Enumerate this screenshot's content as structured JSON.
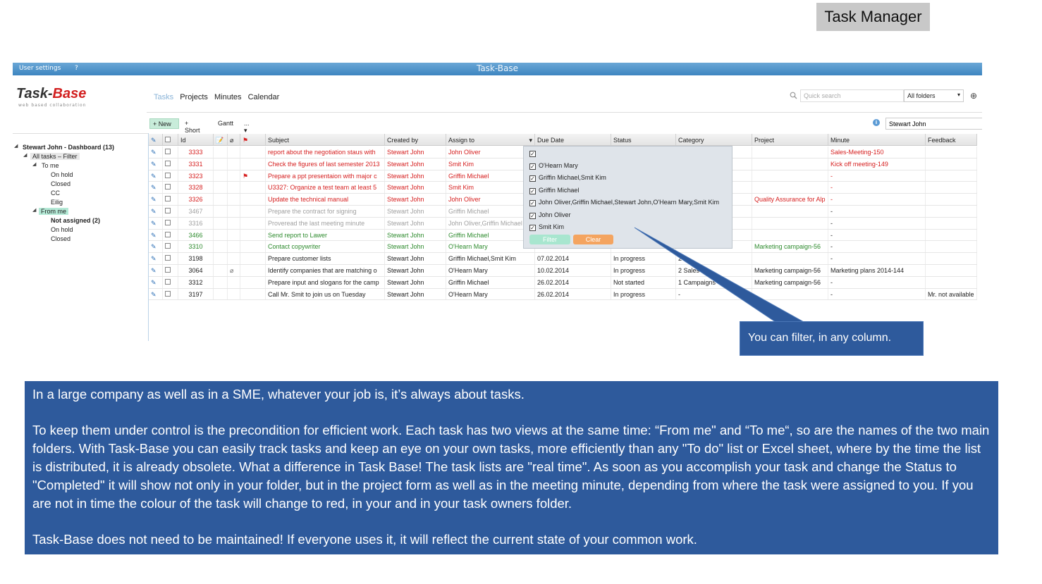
{
  "slide_title": "Task Manager",
  "app": {
    "user_settings": "User settings",
    "help": "?",
    "window_title": "Task-Base",
    "logo_part1": "Task-",
    "logo_part2": "Base",
    "logo_sub": "web based collaboration",
    "nav": [
      "Tasks",
      "Projects",
      "Minutes",
      "Calendar"
    ],
    "search_placeholder": "Quick search",
    "folder_select": "All folders",
    "toolbar": {
      "new": "New",
      "short": "Short",
      "gantt": "Gantt",
      "more": "..."
    },
    "user_select": "Stewart John"
  },
  "tree": {
    "root": "Stewart John - Dashboard (13)",
    "all_tasks": "All tasks – Filter",
    "to_me": "To me",
    "to_me_items": [
      "On hold",
      "Closed",
      "CC",
      "Eilig"
    ],
    "from_me": "From me",
    "not_assigned": "Not assigned (2)",
    "from_me_items": [
      "On hold",
      "Closed"
    ]
  },
  "columns": [
    "Id",
    "Subject",
    "Created by",
    "Assign to",
    "Due Date",
    "Status",
    "Category",
    "Project",
    "Minute",
    "Feedback"
  ],
  "rows": [
    {
      "color": "red",
      "id": "3333",
      "subject": "report about the negotiation staus with",
      "created": "Stewart John",
      "assign": "John Oliver",
      "due": "",
      "status": "",
      "category": "",
      "project": "",
      "minute": "Sales-Meeting-150",
      "feedback": "",
      "flag": false,
      "clip": false
    },
    {
      "color": "red",
      "id": "3331",
      "subject": "Check the figures of last semester 2013",
      "created": "Stewart John",
      "assign": "Smit Kim",
      "due": "",
      "status": "",
      "category": "",
      "project": "",
      "minute": "Kick off meeting-149",
      "feedback": "",
      "flag": false,
      "clip": false
    },
    {
      "color": "red",
      "id": "3323",
      "subject": "Prepare a ppt presentaion with major c",
      "created": "Stewart John",
      "assign": "Griffin Michael",
      "due": "",
      "status": "",
      "category": "",
      "project": "",
      "minute": "-",
      "feedback": "",
      "flag": true,
      "clip": false
    },
    {
      "color": "red",
      "id": "3328",
      "subject": "U3327: Organize a test team at least 5",
      "created": "Stewart John",
      "assign": "Smit Kim",
      "due": "",
      "status": "",
      "category": "ment",
      "project": "",
      "minute": "-",
      "feedback": "",
      "flag": false,
      "clip": false
    },
    {
      "color": "red",
      "id": "3326",
      "subject": "Update the technical manual",
      "created": "Stewart John",
      "assign": "John Oliver",
      "due": "",
      "status": "",
      "category": "ment",
      "project": "Quality Assurance for Alp",
      "minute": "-",
      "feedback": "",
      "flag": false,
      "clip": false
    },
    {
      "color": "gray",
      "id": "3467",
      "subject": "Prepare the contract for signing",
      "created": "Stewart John",
      "assign": "Griffin Michael",
      "due": "",
      "status": "",
      "category": "",
      "project": "",
      "minute": "-",
      "feedback": "",
      "flag": false,
      "clip": false
    },
    {
      "color": "gray",
      "id": "3316",
      "subject": "Proveread the last meeting minute",
      "created": "Stewart John",
      "assign": "John Oliver,Griffin Michael",
      "due": "",
      "status": "",
      "category": "",
      "project": "",
      "minute": "-",
      "feedback": "",
      "flag": false,
      "clip": false
    },
    {
      "color": "green",
      "id": "3466",
      "subject": "Send report to Lawer",
      "created": "Stewart John",
      "assign": "Griffin Michael",
      "due": "",
      "status": "",
      "category": "",
      "project": "",
      "minute": "-",
      "feedback": "",
      "flag": false,
      "clip": false
    },
    {
      "color": "green",
      "id": "3310",
      "subject": "Contact copywriter",
      "created": "Stewart John",
      "assign": "O'Hearn Mary",
      "due": "",
      "status": "",
      "category": "",
      "project": "Marketing campaign-56",
      "minute": "-",
      "feedback": "",
      "flag": false,
      "clip": false
    },
    {
      "color": "black",
      "id": "3198",
      "subject": "Prepare customer lists",
      "created": "Stewart John",
      "assign": "Griffin Michael,Smit Kim",
      "due": "07.02.2014",
      "status": "In progress",
      "category": "2",
      "project": "",
      "minute": "-",
      "feedback": "",
      "flag": false,
      "clip": false
    },
    {
      "color": "black",
      "id": "3064",
      "subject": "Identify companies that are matching o",
      "created": "Stewart John",
      "assign": "O'Hearn Mary",
      "due": "10.02.2014",
      "status": "In progress",
      "category": "2 Sales",
      "project": "Marketing campaign-56",
      "minute": "Marketing plans 2014-144",
      "feedback": "",
      "flag": false,
      "clip": true
    },
    {
      "color": "black",
      "id": "3312",
      "subject": "Prepare input and slogans for the camp",
      "created": "Stewart John",
      "assign": "Griffin Michael",
      "due": "26.02.2014",
      "status": "Not started",
      "category": "1 Campaigns",
      "project": "Marketing campaign-56",
      "minute": "-",
      "feedback": "",
      "flag": false,
      "clip": false
    },
    {
      "color": "black",
      "id": "3197",
      "subject": "Call Mr. Smit to join us on Tuesday",
      "created": "Stewart John",
      "assign": "O'Hearn Mary",
      "due": "26.02.2014",
      "status": "In progress",
      "category": "-",
      "project": "",
      "minute": "-",
      "feedback": "Mr. not available",
      "flag": false,
      "clip": false
    }
  ],
  "filter_popup": {
    "options": [
      "",
      "O'Hearn Mary",
      "Griffin Michael,Smit Kim",
      "Griffin Michael",
      "John Oliver,Griffin Michael,Stewart John,O'Hearn Mary,Smit Kim",
      "John Oliver",
      "Smit Kim"
    ],
    "filter_label": "Filter",
    "clear_label": "Clear"
  },
  "callout": "You can filter, in any column.",
  "description": [
    "In a large company as well as in a SME, whatever your job is, it’s always about tasks.",
    "To keep them under control is the precondition for efficient work. Each task has two views at the same time: “From me\" and “To me“, so are the names of the two main folders. With Task-Base you can easily track tasks and keep an eye on your own tasks,  more efficiently than any \"To do\" list or Excel sheet, where by the time the list is distributed, it is already obsolete. What a difference in Task Base! The task lists are \"real time\". As soon as you accomplish your task and change the Status to \"Completed\" it will show not only in your folder, but in the project form as well as in the meeting minute, depending from where the task were assigned to you. If you are not in time the colour of the task will change to red, in your and in your task owners folder.",
    "Task-Base does not need to be maintained! If everyone uses it, it will reflect the current state of your common work."
  ]
}
